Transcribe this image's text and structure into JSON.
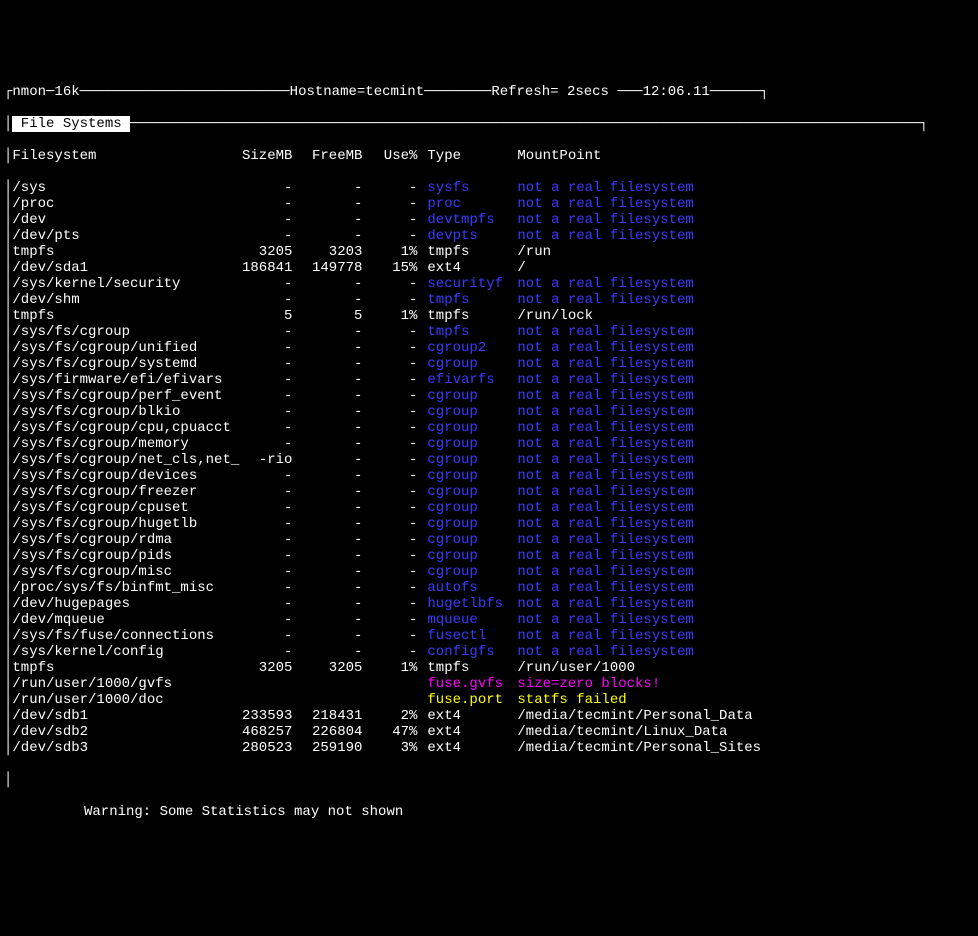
{
  "topbar": {
    "left": "nmon─16k",
    "host_label": "Hostname=",
    "host": "tecmint",
    "refresh_label": "Refresh= ",
    "refresh": "2secs",
    "time": "12:06.11"
  },
  "section": " File Systems ",
  "headers": {
    "fs": "Filesystem",
    "size": "SizeMB",
    "free": "FreeMB",
    "use": "Use%",
    "type": "Type",
    "mount": "MountPoint"
  },
  "rows": [
    {
      "fs": "/sys",
      "size": "-",
      "free": "-",
      "use": "-",
      "type": "sysfs",
      "mount": "not a real filesystem",
      "style": "blue"
    },
    {
      "fs": "/proc",
      "size": "-",
      "free": "-",
      "use": "-",
      "type": "proc",
      "mount": "not a real filesystem",
      "style": "blue"
    },
    {
      "fs": "/dev",
      "size": "-",
      "free": "-",
      "use": "-",
      "type": "devtmpfs",
      "mount": "not a real filesystem",
      "style": "blue"
    },
    {
      "fs": "/dev/pts",
      "size": "-",
      "free": "-",
      "use": "-",
      "type": "devpts",
      "mount": "not a real filesystem",
      "style": "blue"
    },
    {
      "fs": "tmpfs",
      "size": "3205",
      "free": "3203",
      "use": "1%",
      "type": "tmpfs",
      "mount": "/run",
      "style": "white"
    },
    {
      "fs": "/dev/sda1",
      "size": "186841",
      "free": "149778",
      "use": "15%",
      "type": "ext4",
      "mount": "/",
      "style": "white"
    },
    {
      "fs": "/sys/kernel/security",
      "size": "-",
      "free": "-",
      "use": "-",
      "type": "securityf",
      "mount": "not a real filesystem",
      "style": "blue"
    },
    {
      "fs": "/dev/shm",
      "size": "-",
      "free": "-",
      "use": "-",
      "type": "tmpfs",
      "mount": "not a real filesystem",
      "style": "blue"
    },
    {
      "fs": "tmpfs",
      "size": "5",
      "free": "5",
      "use": "1%",
      "type": "tmpfs",
      "mount": "/run/lock",
      "style": "white"
    },
    {
      "fs": "/sys/fs/cgroup",
      "size": "-",
      "free": "-",
      "use": "-",
      "type": "tmpfs",
      "mount": "not a real filesystem",
      "style": "blue"
    },
    {
      "fs": "/sys/fs/cgroup/unified",
      "size": "-",
      "free": "-",
      "use": "-",
      "type": "cgroup2",
      "mount": "not a real filesystem",
      "style": "blue"
    },
    {
      "fs": "/sys/fs/cgroup/systemd",
      "size": "-",
      "free": "-",
      "use": "-",
      "type": "cgroup",
      "mount": "not a real filesystem",
      "style": "blue"
    },
    {
      "fs": "/sys/firmware/efi/efivars",
      "size": "-",
      "free": "-",
      "use": "-",
      "type": "efivarfs",
      "mount": "not a real filesystem",
      "style": "blue"
    },
    {
      "fs": "/sys/fs/cgroup/perf_event",
      "size": "-",
      "free": "-",
      "use": "-",
      "type": "cgroup",
      "mount": "not a real filesystem",
      "style": "blue"
    },
    {
      "fs": "/sys/fs/cgroup/blkio",
      "size": "-",
      "free": "-",
      "use": "-",
      "type": "cgroup",
      "mount": "not a real filesystem",
      "style": "blue"
    },
    {
      "fs": "/sys/fs/cgroup/cpu,cpuacct",
      "size": "-",
      "free": "-",
      "use": "-",
      "type": "cgroup",
      "mount": "not a real filesystem",
      "style": "blue"
    },
    {
      "fs": "/sys/fs/cgroup/memory",
      "size": "-",
      "free": "-",
      "use": "-",
      "type": "cgroup",
      "mount": "not a real filesystem",
      "style": "blue"
    },
    {
      "fs": "/sys/fs/cgroup/net_cls,net_",
      "size": "-rio",
      "free": "-",
      "use": "-",
      "type": "cgroup",
      "mount": "not a real filesystem",
      "style": "blue"
    },
    {
      "fs": "/sys/fs/cgroup/devices",
      "size": "-",
      "free": "-",
      "use": "-",
      "type": "cgroup",
      "mount": "not a real filesystem",
      "style": "blue"
    },
    {
      "fs": "/sys/fs/cgroup/freezer",
      "size": "-",
      "free": "-",
      "use": "-",
      "type": "cgroup",
      "mount": "not a real filesystem",
      "style": "blue"
    },
    {
      "fs": "/sys/fs/cgroup/cpuset",
      "size": "-",
      "free": "-",
      "use": "-",
      "type": "cgroup",
      "mount": "not a real filesystem",
      "style": "blue"
    },
    {
      "fs": "/sys/fs/cgroup/hugetlb",
      "size": "-",
      "free": "-",
      "use": "-",
      "type": "cgroup",
      "mount": "not a real filesystem",
      "style": "blue"
    },
    {
      "fs": "/sys/fs/cgroup/rdma",
      "size": "-",
      "free": "-",
      "use": "-",
      "type": "cgroup",
      "mount": "not a real filesystem",
      "style": "blue"
    },
    {
      "fs": "/sys/fs/cgroup/pids",
      "size": "-",
      "free": "-",
      "use": "-",
      "type": "cgroup",
      "mount": "not a real filesystem",
      "style": "blue"
    },
    {
      "fs": "/sys/fs/cgroup/misc",
      "size": "-",
      "free": "-",
      "use": "-",
      "type": "cgroup",
      "mount": "not a real filesystem",
      "style": "blue"
    },
    {
      "fs": "/proc/sys/fs/binfmt_misc",
      "size": "-",
      "free": "-",
      "use": "-",
      "type": "autofs",
      "mount": "not a real filesystem",
      "style": "blue"
    },
    {
      "fs": "/dev/hugepages",
      "size": "-",
      "free": "-",
      "use": "-",
      "type": "hugetlbfs",
      "mount": "not a real filesystem",
      "style": "blue"
    },
    {
      "fs": "/dev/mqueue",
      "size": "-",
      "free": "-",
      "use": "-",
      "type": "mqueue",
      "mount": "not a real filesystem",
      "style": "blue"
    },
    {
      "fs": "/sys/fs/fuse/connections",
      "size": "-",
      "free": "-",
      "use": "-",
      "type": "fusectl",
      "mount": "not a real filesystem",
      "style": "blue"
    },
    {
      "fs": "/sys/kernel/config",
      "size": "-",
      "free": "-",
      "use": "-",
      "type": "configfs",
      "mount": "not a real filesystem",
      "style": "blue"
    },
    {
      "fs": "tmpfs",
      "size": "3205",
      "free": "3205",
      "use": "1%",
      "type": "tmpfs",
      "mount": "/run/user/1000",
      "style": "white"
    },
    {
      "fs": "/run/user/1000/gvfs",
      "size": "",
      "free": "",
      "use": "",
      "type": "fuse.gvfs",
      "mount": "size=zero blocks!",
      "style": "magenta"
    },
    {
      "fs": "/run/user/1000/doc",
      "size": "",
      "free": "",
      "use": "",
      "type": "fuse.port",
      "mount": "statfs failed",
      "style": "yellow"
    },
    {
      "fs": "/dev/sdb1",
      "size": "233593",
      "free": "218431",
      "use": "2%",
      "type": "ext4",
      "mount": "/media/tecmint/Personal_Data",
      "style": "white"
    },
    {
      "fs": "/dev/sdb2",
      "size": "468257",
      "free": "226804",
      "use": "47%",
      "type": "ext4",
      "mount": "/media/tecmint/Linux_Data",
      "style": "white"
    },
    {
      "fs": "/dev/sdb3",
      "size": "280523",
      "free": "259190",
      "use": "3%",
      "type": "ext4",
      "mount": "/media/tecmint/Personal_Sites",
      "style": "white"
    }
  ],
  "warning": "Warning: Some Statistics may not shown"
}
